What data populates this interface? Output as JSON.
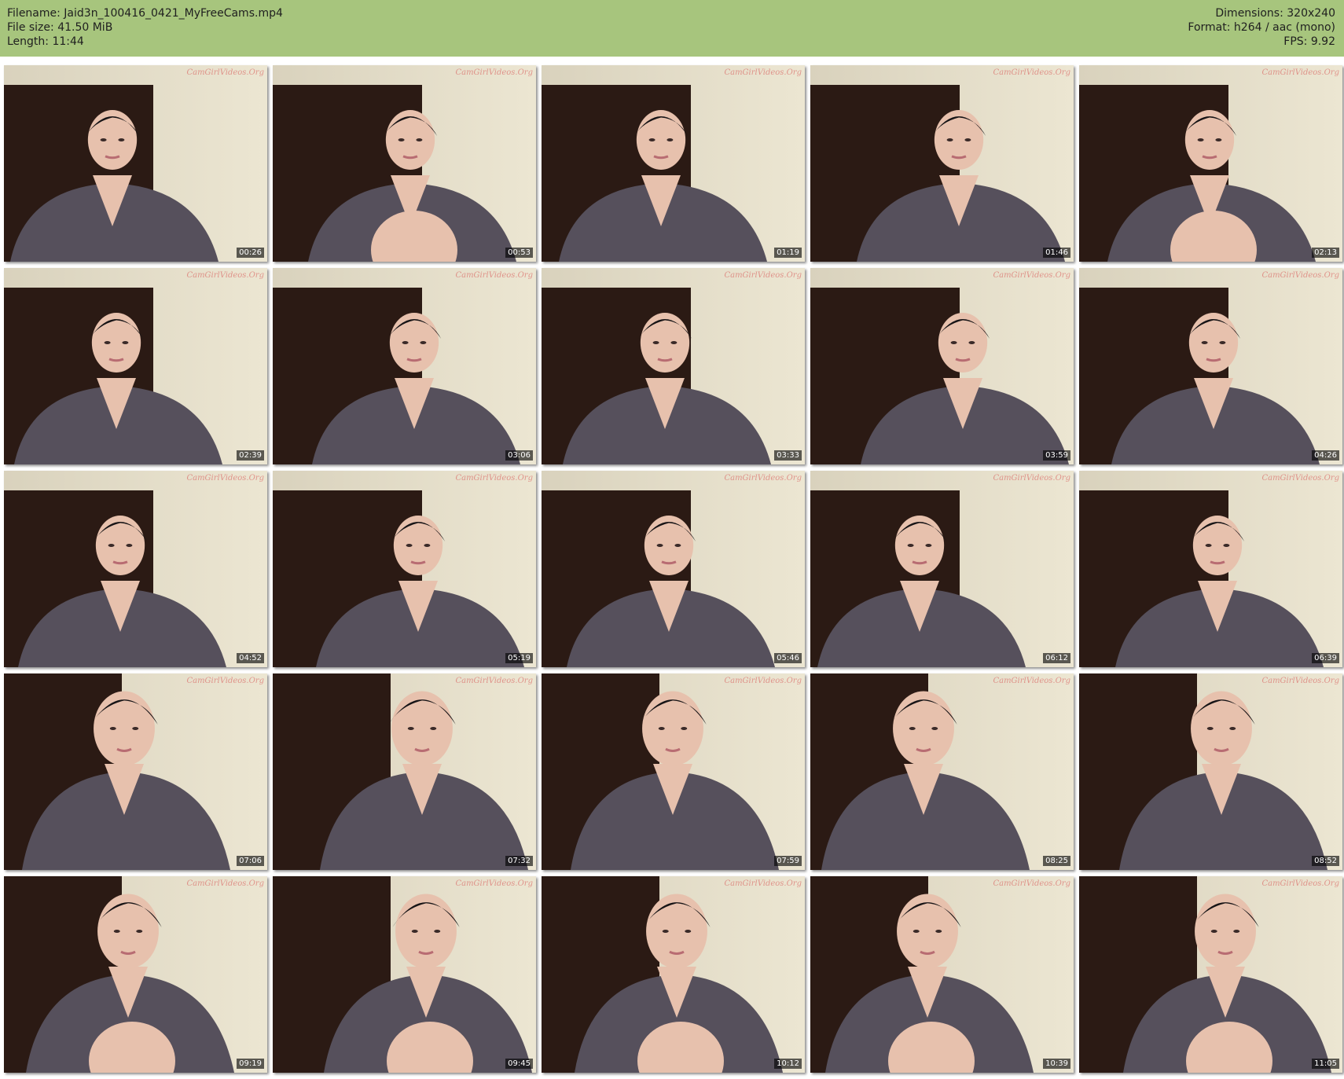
{
  "header": {
    "left": [
      "Filename: Jaid3n_100416_0421_MyFreeCams.mp4",
      "File size: 41.50 MiB",
      "Length: 11:44"
    ],
    "right": [
      "Dimensions: 320x240",
      "Format: h264 / aac (mono)",
      "FPS: 9.92"
    ]
  },
  "colors": {
    "header_bg": "#a7c57d",
    "wall": "#ece6d2",
    "curtain": "#2b1a14",
    "sweater": "#56505c",
    "skin": "#e7c1ad",
    "hair": "#171416"
  },
  "watermark": "CamGirlVideos.Org",
  "thumbnails": [
    {
      "time": "00:26"
    },
    {
      "time": "00:53"
    },
    {
      "time": "01:19"
    },
    {
      "time": "01:46"
    },
    {
      "time": "02:13"
    },
    {
      "time": "02:39"
    },
    {
      "time": "03:06"
    },
    {
      "time": "03:33"
    },
    {
      "time": "03:59"
    },
    {
      "time": "04:26"
    },
    {
      "time": "04:52"
    },
    {
      "time": "05:19"
    },
    {
      "time": "05:46"
    },
    {
      "time": "06:12"
    },
    {
      "time": "06:39"
    },
    {
      "time": "07:06"
    },
    {
      "time": "07:32"
    },
    {
      "time": "07:59"
    },
    {
      "time": "08:25"
    },
    {
      "time": "08:52"
    },
    {
      "time": "09:19"
    },
    {
      "time": "09:45"
    },
    {
      "time": "10:12"
    },
    {
      "time": "10:39"
    },
    {
      "time": "11:05"
    }
  ]
}
